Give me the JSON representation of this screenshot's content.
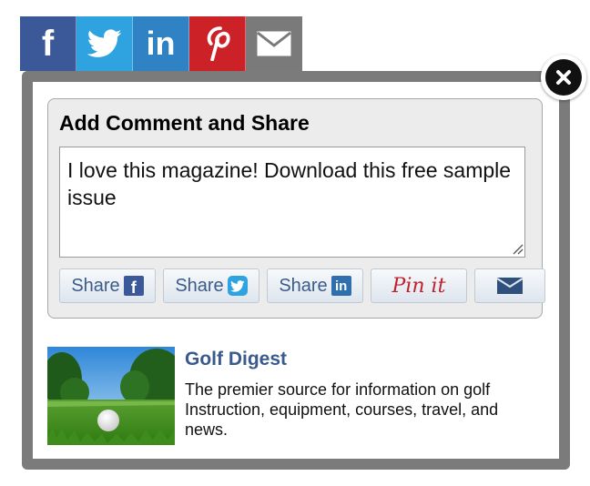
{
  "social_bar": {
    "items": [
      {
        "name": "facebook",
        "glyph": "f",
        "color": "#3b5998"
      },
      {
        "name": "twitter",
        "color": "#2ea3e0"
      },
      {
        "name": "linkedin",
        "glyph": "in",
        "color": "#2f82c4"
      },
      {
        "name": "pinterest",
        "color": "#cc2127"
      },
      {
        "name": "email",
        "color": "#7a7a7a"
      }
    ]
  },
  "modal": {
    "title": "Add Comment and Share",
    "comment": {
      "value": "I love this magazine! Download this free sample issue"
    },
    "share_buttons": [
      {
        "name": "facebook",
        "label": "Share",
        "icon": "f",
        "icon_color": "#3b5998"
      },
      {
        "name": "twitter",
        "label": "Share",
        "icon_color": "#2ea3e0"
      },
      {
        "name": "linkedin",
        "label": "Share",
        "icon": "in",
        "icon_color": "#2f6fb0"
      },
      {
        "name": "pinterest",
        "label": "Pin it"
      },
      {
        "name": "email",
        "icon_color": "#2f4f7f"
      }
    ]
  },
  "promo": {
    "title": "Golf Digest",
    "description": "The premier source for information on golf Instruction, equipment, courses, travel, and news."
  },
  "colors": {
    "frame": "#7b7b7b",
    "panel_bg": "#ececec",
    "link": "#3a5a8e"
  }
}
